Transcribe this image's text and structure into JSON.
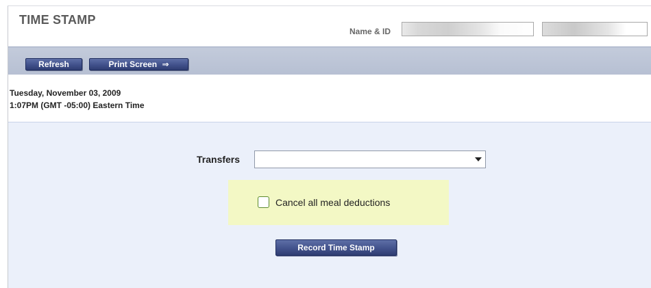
{
  "header": {
    "title": "TIME STAMP",
    "name_id_label": "Name & ID",
    "name_value": "",
    "id_value": ""
  },
  "toolbar": {
    "refresh_label": "Refresh",
    "print_screen_label": "Print Screen",
    "print_screen_icon": "arrow-right"
  },
  "datebar": {
    "date": "Tuesday, November 03, 2009",
    "time": "1:07PM (GMT -05:00) Eastern Time"
  },
  "main": {
    "transfers_label": "Transfers",
    "transfers_selected": "",
    "meal_checkbox_label": "Cancel all meal deductions",
    "meal_checkbox_checked": false,
    "record_button_label": "Record Time Stamp"
  },
  "colors": {
    "button_blue": "#41518b",
    "toolbar_blue": "#b7c0d3",
    "main_bg": "#ebf0fa",
    "meal_panel_bg": "#f3f8c5"
  }
}
